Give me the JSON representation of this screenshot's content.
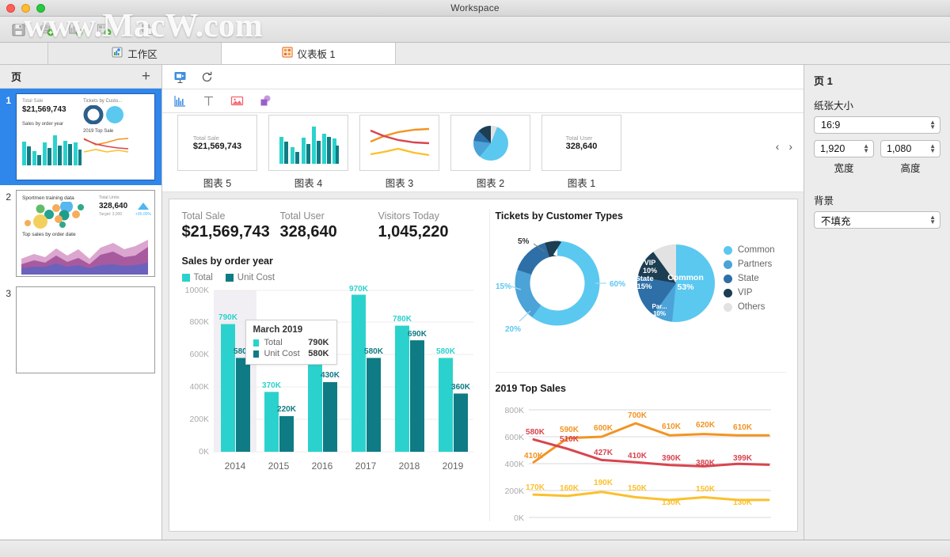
{
  "window": {
    "title": "Workspace",
    "watermark": "www.MacW.com"
  },
  "toolbar": {
    "buttons": [
      {
        "name": "save-icon",
        "label": "保存"
      },
      {
        "name": "add-data-source-icon",
        "label": "添加数据源"
      },
      {
        "name": "add-chart-icon",
        "label": "添加图表"
      },
      {
        "name": "add-dashboard-icon",
        "label": "添加仪表板"
      },
      {
        "name": "duplicate-icon",
        "label": "复制"
      }
    ]
  },
  "tabs": [
    {
      "label": "工作区",
      "icon": "workspace-icon",
      "active": false
    },
    {
      "label": "仪表板 1",
      "icon": "dashboard-icon",
      "active": true
    }
  ],
  "pages_panel": {
    "title": "页",
    "add_label": "+",
    "items": [
      {
        "number": "1",
        "selected": true,
        "kind": "dashboard-1"
      },
      {
        "number": "2",
        "selected": false,
        "kind": "dashboard-2"
      },
      {
        "number": "3",
        "selected": false,
        "kind": "blank"
      }
    ],
    "thumb1": {
      "total_sale_label": "Total Sale",
      "total_sale_value": "$21,569,743",
      "tickets_label": "Tickets by Custo...",
      "sales_label": "Sales by order year",
      "top_sale_label": "2019 Top Sale"
    },
    "thumb2": {
      "sportmen_label": "Sportmen training data",
      "total_units_label": "Total Units",
      "total_units_value": "328,640",
      "target_label": "Target: 3,000",
      "delta_label": "+95.00%",
      "top_sales_label": "Top sales by order date"
    }
  },
  "center_toolbar": {
    "row1": [
      {
        "name": "present-icon",
        "label": "演示"
      },
      {
        "name": "refresh-icon",
        "label": "刷新"
      }
    ],
    "row2": [
      {
        "name": "chart-icon",
        "label": "图表"
      },
      {
        "name": "text-icon",
        "label": "文本"
      },
      {
        "name": "image-icon",
        "label": "图片"
      },
      {
        "name": "shape-icon",
        "label": "形状"
      }
    ]
  },
  "gallery": {
    "items": [
      {
        "label": "图表 5",
        "type": "kpi",
        "kpi_label": "Total Sale",
        "kpi_value": "$21,569,743"
      },
      {
        "label": "图表 4",
        "type": "bar"
      },
      {
        "label": "图表 3",
        "type": "line"
      },
      {
        "label": "图表 2",
        "type": "pie"
      },
      {
        "label": "图表 1",
        "type": "kpi",
        "kpi_label": "Total User",
        "kpi_value": "328,640"
      }
    ],
    "prev_label": "‹",
    "next_label": "›"
  },
  "inspector": {
    "title": "页 1",
    "paper_size_label": "纸张大小",
    "paper_size_value": "16:9",
    "width_value": "1,920",
    "height_value": "1,080",
    "width_label": "宽度",
    "height_label": "高度",
    "background_label": "背景",
    "background_value": "不填充"
  },
  "dashboard": {
    "kpis": [
      {
        "label": "Total Sale",
        "value": "$21,569,743"
      },
      {
        "label": "Total User",
        "value": "328,640"
      },
      {
        "label": "Visitors Today",
        "value": "1,045,220"
      }
    ],
    "bar_section_title": "Sales by order year",
    "tooltip": {
      "title": "March 2019",
      "rows": [
        {
          "name": "Total",
          "value": "790K",
          "color": "#2bd2cd"
        },
        {
          "name": "Unit Cost",
          "value": "580K",
          "color": "#0f7b84"
        }
      ]
    },
    "tickets_title": "Tickets by Customer Types",
    "top_sales_title": "2019 Top Sales"
  },
  "chart_data": [
    {
      "type": "bar",
      "title": "Sales by order year",
      "categories": [
        "2014",
        "2015",
        "2016",
        "2017",
        "2018",
        "2019"
      ],
      "series": [
        {
          "name": "Total",
          "color": "#2bd2cd",
          "values": [
            790,
            370,
            620,
            970,
            780,
            580
          ],
          "labels": [
            "790K",
            "370K",
            "620K",
            "970K",
            "780K",
            "580K"
          ]
        },
        {
          "name": "Unit Cost",
          "color": "#0f7b84",
          "values": [
            580,
            220,
            430,
            580,
            690,
            360
          ],
          "labels": [
            "580K",
            "220K",
            "430K",
            "580K",
            "690K",
            "360K"
          ]
        }
      ],
      "ylabel": "",
      "xlabel": "",
      "ylim": [
        0,
        1000
      ],
      "yticks": [
        "0K",
        "200K",
        "400K",
        "600K",
        "800K",
        "1000K"
      ],
      "grid": true,
      "legend": [
        "Total",
        "Unit Cost"
      ],
      "legend_position": "top",
      "highlighted_category": "2014"
    },
    {
      "type": "pie",
      "title": "Tickets by Customer Types",
      "variant": "donut",
      "labels": [
        "60%",
        "20%",
        "15%",
        "5%"
      ],
      "values": [
        60,
        20,
        15,
        5
      ],
      "colors": [
        "#5bc8f0",
        "#4ba3d8",
        "#2e6fa8",
        "#1c3d52"
      ],
      "legend": [
        "Common",
        "Partners",
        "State",
        "VIP",
        "Others"
      ],
      "legend_colors": [
        "#5bc8f0",
        "#4ba3d8",
        "#2e6fa8",
        "#1c3d52",
        "#e2e2e2"
      ],
      "legend_position": "right"
    },
    {
      "type": "pie",
      "title": "Tickets by Customer Types",
      "variant": "pie",
      "labels": [
        "Common 53%",
        "Par... 10%",
        "State 15%",
        "VIP 10%",
        "Others"
      ],
      "slice_names": [
        "Common",
        "Par...",
        "State",
        "VIP",
        "Others"
      ],
      "values": [
        53,
        10,
        15,
        10,
        12
      ],
      "value_labels": [
        "53%",
        "10%",
        "15%",
        "10%",
        ""
      ],
      "colors": [
        "#5bc8f0",
        "#4ba3d8",
        "#2e6fa8",
        "#1c3d52",
        "#e2e2e2"
      ]
    },
    {
      "type": "line",
      "title": "2019 Top Sales",
      "x": [
        1,
        2,
        3,
        4,
        5,
        6,
        7,
        8
      ],
      "ylim": [
        0,
        800
      ],
      "yticks": [
        "0K",
        "200K",
        "400K",
        "600K",
        "800K"
      ],
      "grid": true,
      "series": [
        {
          "name": "orange",
          "color": "#f29423",
          "values": [
            410,
            590,
            600,
            700,
            610,
            620,
            610,
            610
          ],
          "labels": [
            "410K",
            "590K",
            "600K",
            "700K",
            "610K",
            "620K",
            "610K",
            ""
          ]
        },
        {
          "name": "red",
          "color": "#d9444f",
          "values": [
            580,
            510,
            427,
            410,
            390,
            380,
            399,
            399
          ],
          "labels": [
            "580K",
            "510K",
            "427K",
            "410K",
            "390K",
            "380K",
            "399K",
            ""
          ]
        },
        {
          "name": "yellow",
          "color": "#fbc02d",
          "values": [
            170,
            160,
            190,
            150,
            130,
            150,
            130,
            130
          ],
          "labels": [
            "170K",
            "160K",
            "190K",
            "150K",
            "130K",
            "150K",
            "130K",
            ""
          ]
        }
      ]
    }
  ]
}
